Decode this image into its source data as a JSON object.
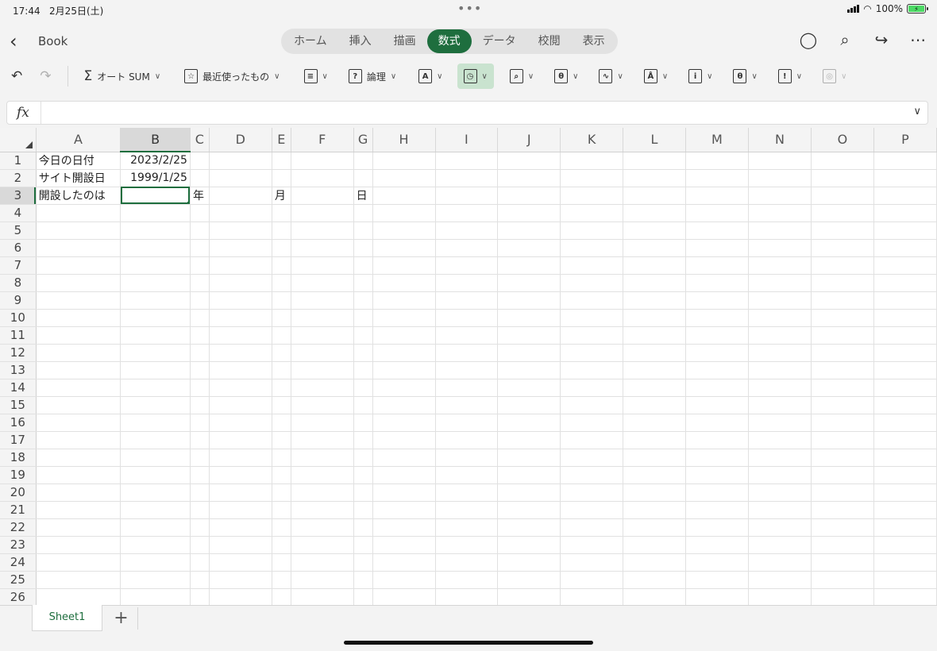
{
  "status": {
    "time": "17:44",
    "date": "2月25日(土)",
    "battery": "100%"
  },
  "header": {
    "back_icon": "chevron-left-icon",
    "doc_title": "Book",
    "tabs": [
      "ホーム",
      "挿入",
      "描画",
      "数式",
      "データ",
      "校閲",
      "表示"
    ],
    "active_tab": "数式"
  },
  "ribbon": {
    "autosum_label": "オート SUM",
    "recent_label": "最近使ったもの",
    "logical_label": "論理"
  },
  "formula_bar": {
    "fx_label": "fx",
    "value": ""
  },
  "grid": {
    "columns": [
      "A",
      "B",
      "C",
      "D",
      "E",
      "F",
      "G",
      "H",
      "I",
      "J",
      "K",
      "L",
      "M",
      "N",
      "O",
      "P"
    ],
    "rows": [
      "1",
      "2",
      "3",
      "4",
      "5",
      "6",
      "7",
      "8",
      "9",
      "10",
      "11",
      "12",
      "13",
      "14",
      "15",
      "16",
      "17",
      "18",
      "19",
      "20",
      "21",
      "22",
      "23",
      "24",
      "25",
      "26"
    ],
    "active_cell": "B3",
    "cells": {
      "A1": "今日の日付",
      "B1": "2023/2/25",
      "A2": "サイト開設日",
      "B2": "1999/1/25",
      "A3": "開設したのは",
      "C3": "年",
      "E3": "月",
      "G3": "日"
    }
  },
  "sheets": {
    "names": [
      "Sheet1"
    ],
    "add_label": "+"
  },
  "colors": {
    "accent": "#1e6e3e",
    "ribbon_selected": "#c9e3cf"
  }
}
